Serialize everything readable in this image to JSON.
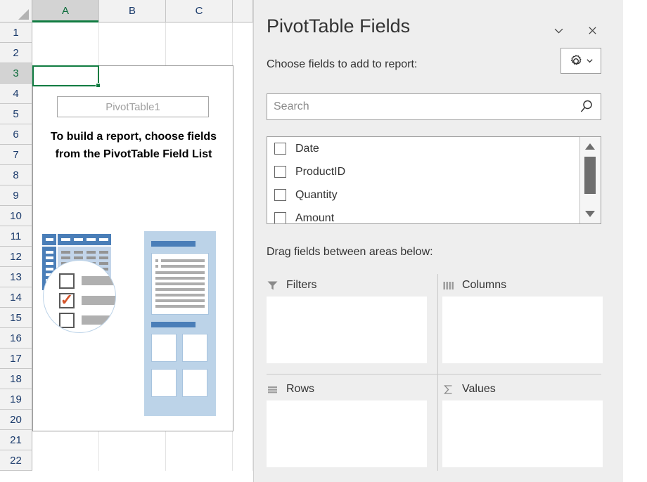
{
  "spreadsheet": {
    "columns": [
      "A",
      "B",
      "C"
    ],
    "selected_column": "A",
    "rows": [
      "1",
      "2",
      "3",
      "4",
      "5",
      "6",
      "7",
      "8",
      "9",
      "10",
      "11",
      "12",
      "13",
      "14",
      "15",
      "16",
      "17",
      "18",
      "19",
      "20",
      "21",
      "22"
    ],
    "selected_cell": "A3",
    "pivot_placeholder": {
      "name": "PivotTable1",
      "message": "To build a report, choose fields from the PivotTable Field List"
    }
  },
  "pane": {
    "title": "PivotTable Fields",
    "collapse_label": "",
    "close_label": "",
    "choose_label": "Choose fields to add to report:",
    "tools_label": "",
    "search": {
      "placeholder": "Search",
      "value": ""
    },
    "fields": [
      {
        "label": "Date",
        "checked": false
      },
      {
        "label": "ProductID",
        "checked": false
      },
      {
        "label": "Quantity",
        "checked": false
      },
      {
        "label": "Amount",
        "checked": false
      }
    ],
    "drag_label": "Drag fields between areas below:",
    "areas": [
      {
        "name": "Filters",
        "icon": "filter-icon",
        "items": []
      },
      {
        "name": "Columns",
        "icon": "columns-icon",
        "items": []
      },
      {
        "name": "Rows",
        "icon": "rows-icon",
        "items": []
      },
      {
        "name": "Values",
        "icon": "sigma-icon",
        "items": []
      }
    ]
  },
  "colors": {
    "excel_green": "#107c41",
    "pane_bg": "#eeeeee",
    "illustration_blue": "#4a7eb8",
    "illustration_light_blue": "#c3d5ea",
    "check_orange": "#d4542a"
  }
}
